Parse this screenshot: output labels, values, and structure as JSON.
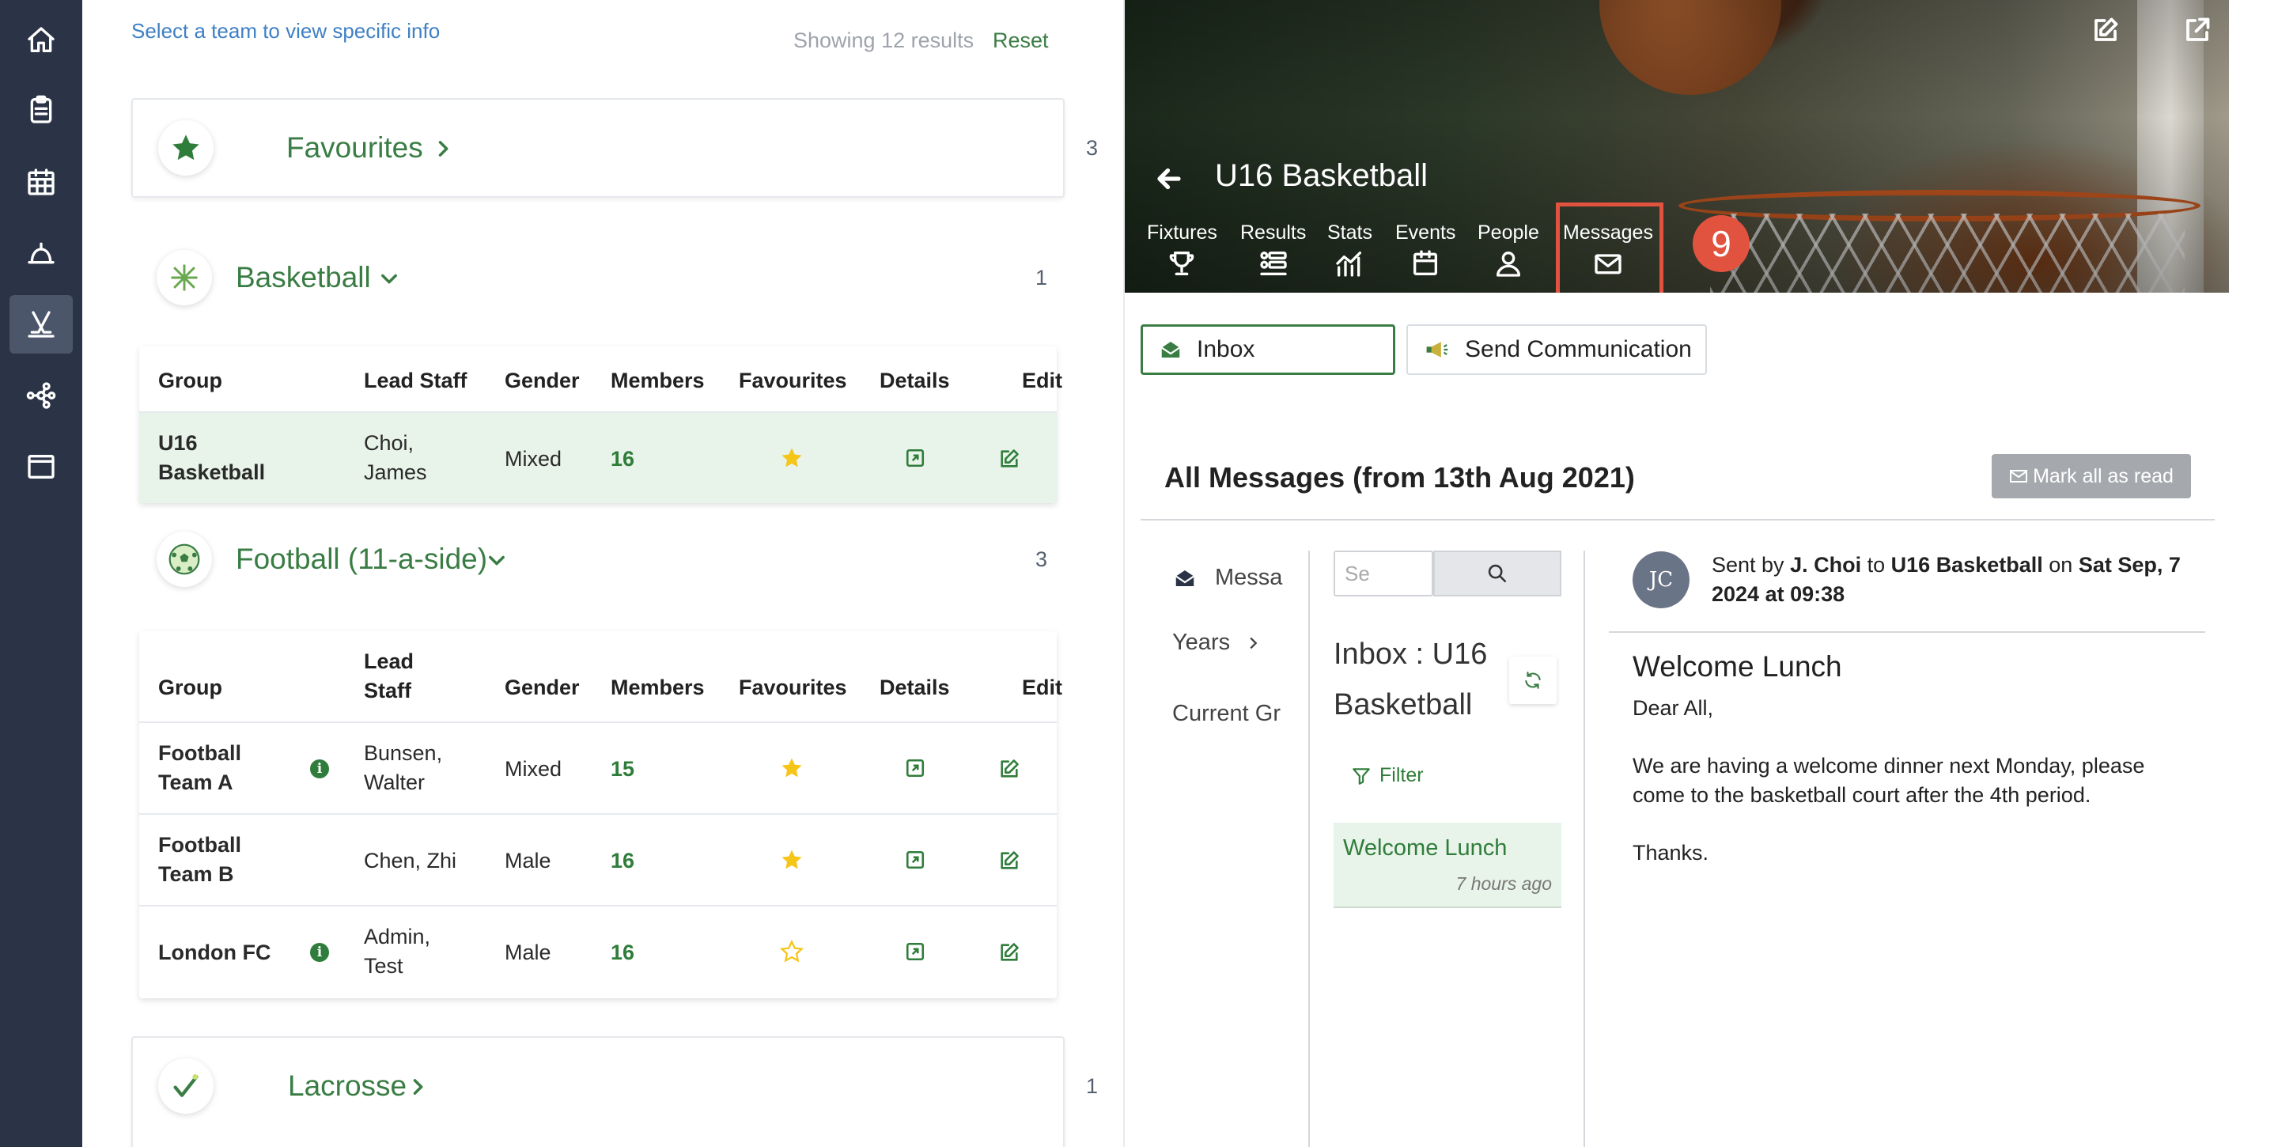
{
  "sidebar": {
    "icons": [
      "home-icon",
      "clipboard-icon",
      "calendar-icon",
      "whistle-icon",
      "hockey-sticks-icon",
      "network-icon",
      "window-icon"
    ],
    "active": "hockey-sticks-icon"
  },
  "left": {
    "hint": "Select a team to view specific info",
    "showing": "Showing 12 results",
    "reset": "Reset",
    "sections": {
      "favourites": {
        "title": "Favourites",
        "count": "3"
      },
      "basketball": {
        "title": "Basketball",
        "count": "1"
      },
      "football": {
        "title": "Football (11-a-side)",
        "count": "3"
      },
      "lacrosse": {
        "title": "Lacrosse",
        "count": "1"
      }
    },
    "columns": {
      "group": "Group",
      "lead_staff": "Lead Staff",
      "lead_staff_l1": "Lead",
      "lead_staff_l2": "Staff",
      "gender": "Gender",
      "members": "Members",
      "favourites": "Favourites",
      "details": "Details",
      "edit": "Edit"
    },
    "basketball_rows": [
      {
        "group_l1": "U16",
        "group_l2": "Basketball",
        "staff_l1": "Choi,",
        "staff_l2": "James",
        "gender": "Mixed",
        "members": "16",
        "favourite": true
      }
    ],
    "football_rows": [
      {
        "group_l1": "Football",
        "group_l2": "Team A",
        "info": true,
        "staff_l1": "Bunsen,",
        "staff_l2": "Walter",
        "gender": "Mixed",
        "members": "15",
        "favourite": true
      },
      {
        "group_l1": "Football",
        "group_l2": "Team B",
        "info": false,
        "staff_l1": "Chen, Zhi",
        "staff_l2": "",
        "gender": "Male",
        "members": "16",
        "favourite": true
      },
      {
        "group_l1": "London FC",
        "group_l2": "",
        "info": true,
        "staff_l1": "Admin,",
        "staff_l2": "Test",
        "gender": "Male",
        "members": "16",
        "favourite": false
      }
    ]
  },
  "right": {
    "team_title": "U16 Basketball",
    "tabs": [
      "Fixtures",
      "Results",
      "Stats",
      "Events",
      "People",
      "Messages"
    ],
    "step_badge": "9",
    "inbox_button": "Inbox",
    "send_button": "Send Communication",
    "heading": "All Messages (from 13th Aug 2021)",
    "mark_all": "Mark all as read",
    "nav": {
      "messages": "Messa",
      "years": "Years",
      "current": "Current Gr"
    },
    "search_placeholder": "Se",
    "inbox_title": "Inbox : U16 Basketball",
    "filter": "Filter",
    "message_item": {
      "title": "Welcome Lunch",
      "age": "7 hours ago"
    },
    "message": {
      "avatar": "JC",
      "sent_by_label": "Sent by",
      "sender": "J. Choi",
      "to_label": "to",
      "recipient": "U16 Basketball",
      "on_label": "on",
      "date": "Sat Sep, 7 2024 at 09:38",
      "subject": "Welcome Lunch",
      "greeting": "Dear All,",
      "body_l1": "We are having a welcome dinner next Monday, please",
      "body_l2": "come to the basketball court after the 4th period.",
      "signoff": "Thanks."
    }
  },
  "colors": {
    "brand_green": "#3a7d44",
    "sidebar_bg": "#2b3446",
    "highlight_red": "#e2533f",
    "star_yellow": "#f5c518"
  }
}
